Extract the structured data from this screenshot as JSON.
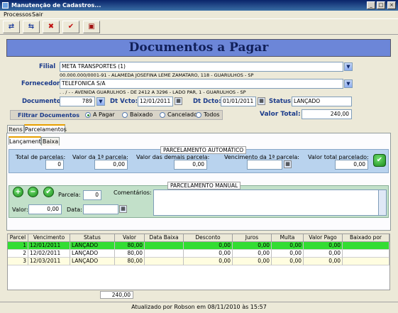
{
  "window": {
    "title": "Manutenção de Cadastros..."
  },
  "menu": [
    "Processos",
    "Sair"
  ],
  "header": {
    "title": "Documentos a Pagar"
  },
  "filial": {
    "label": "Filial",
    "value": "META TRANSPORTES (1)",
    "address": "00.000.000/0001-91 - ALAMEDA JOSEFINA LEME ZAMATARO, 118 - GUARULHOS - SP"
  },
  "fornecedor": {
    "label": "Fornecedor",
    "value": "TELEFONICA S/A",
    "address": ". . / - - AVENIDA GUARULHOS - DE 2412 A 3296 - LADO PAR, 1 - GUARULHOS - SP"
  },
  "documento": {
    "label": "Documento",
    "value": "789",
    "dt_vcto_label": "Dt Vcto:",
    "dt_vcto": "12/01/2011",
    "dt_dcto_label": "Dt Dcto:",
    "dt_dcto": "01/01/2011",
    "status_label": "Status:",
    "status": "LANÇADO"
  },
  "filter": {
    "label": "Filtrar Documentos",
    "options": [
      "A Pagar",
      "Baixado",
      "Cancelados",
      "Todos"
    ],
    "selected": "A Pagar"
  },
  "valor_total": {
    "label": "Valor Total:",
    "value": "240,00"
  },
  "tabs": [
    "Itens",
    "Parcelamentos"
  ],
  "subtabs": [
    "Lançamento",
    "Baixa"
  ],
  "auto": {
    "title": "PARCELAMENTO AUTOMÁTICO",
    "total_parcelas_label": "Total de parcelas:",
    "total_parcelas": "0",
    "valor_1_label": "Valor da 1ª parcela:",
    "valor_1": "0,00",
    "valor_demais_label": "Valor das demais parcela:",
    "valor_demais": "0,00",
    "vencimento_label": "Vencimento da 1ª parcela:",
    "vencimento": "",
    "total_label": "Valor total parcelado:",
    "total": "0,00"
  },
  "manual": {
    "title": "PARCELAMENTO MANUAL",
    "parcela_label": "Parcela:",
    "parcela": "0",
    "comentarios_label": "Comentários:",
    "valor_label": "Valor:",
    "valor": "0,00",
    "data_label": "Data:",
    "data": ""
  },
  "grid": {
    "columns": [
      "Parcel",
      "Vencimento",
      "Status",
      "Valor",
      "Data Baixa",
      "Desconto",
      "Juros",
      "Multa",
      "Valor Pago",
      "Baixado por"
    ],
    "rows": [
      [
        "1",
        "12/01/2011",
        "LANÇADO",
        "80,00",
        "",
        "0,00",
        "0,00",
        "0,00",
        "0,00",
        ""
      ],
      [
        "2",
        "12/02/2011",
        "LANÇADO",
        "80,00",
        "",
        "0,00",
        "0,00",
        "0,00",
        "0,00",
        ""
      ],
      [
        "3",
        "12/03/2011",
        "LANÇADO",
        "80,00",
        "",
        "0,00",
        "0,00",
        "0,00",
        "0,00",
        ""
      ]
    ]
  },
  "footer_total": "240,00",
  "status_text": "Atualizado por Robson em 08/11/2010 às 15:57",
  "colors": {
    "header_bg": "#6c86d8",
    "selected_row": "#33dd33",
    "group_auto": "#b9d3ee",
    "group_manual": "#c2e0c9"
  }
}
